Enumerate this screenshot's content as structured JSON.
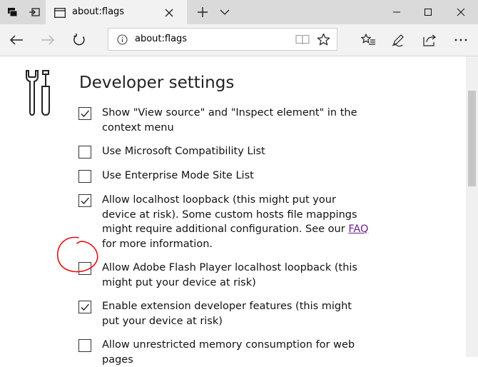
{
  "browser": {
    "tab_title": "about:flags",
    "url": "about:flags"
  },
  "page": {
    "heading": "Developer settings",
    "settings": [
      {
        "text": "Show \"View source\" and \"Inspect element\" in the context menu",
        "checked": true
      },
      {
        "text": "Use Microsoft Compatibility List",
        "checked": false
      },
      {
        "text": "Use Enterprise Mode Site List",
        "checked": false
      },
      {
        "text_before": "Allow localhost loopback (this might put your device at risk). Some custom hosts file mappings might require additional configuration. See our ",
        "link": "FAQ",
        "text_after": " for more information.",
        "checked": true
      },
      {
        "text": "Allow Adobe Flash Player localhost loopback (this might put your device at risk)",
        "checked": false
      },
      {
        "text": "Enable extension developer features (this might put your device at risk)",
        "checked": true
      },
      {
        "text": "Allow unrestricted memory consumption for web pages",
        "checked": false
      }
    ]
  },
  "colors": {
    "annotation": "#e01010",
    "link": "#6b2190"
  }
}
